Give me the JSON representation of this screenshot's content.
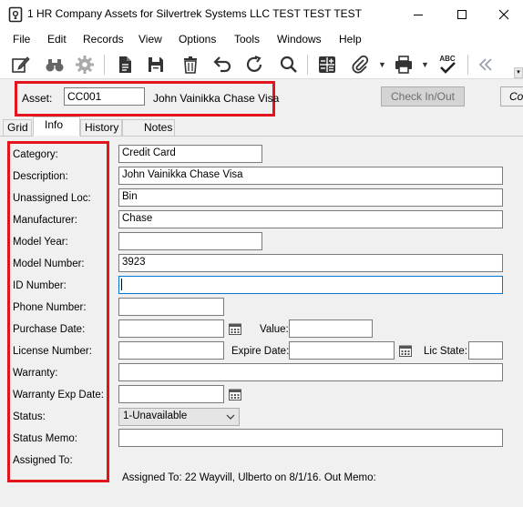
{
  "window": {
    "title": "1 HR Company Assets for Silvertrek Systems LLC TEST TEST TEST",
    "controls": [
      "minimize-icon",
      "maximize-icon",
      "close-icon"
    ]
  },
  "menu": [
    "File",
    "Edit",
    "Records",
    "View",
    "Options",
    "Tools",
    "Windows",
    "Help"
  ],
  "toolbar": {
    "icons": [
      "edit-icon",
      "binoculars-icon",
      "gear-icon",
      "document-icon",
      "save-icon",
      "delete-icon",
      "undo-icon",
      "redo-icon",
      "search-icon",
      "calculator-icon",
      "attach-icon",
      "print-icon",
      "spellcheck-icon",
      "collapse-icon"
    ],
    "spell_label": "ABC"
  },
  "asset": {
    "label": "Asset:",
    "code": "CC001",
    "description": "John Vainikka Chase Visa",
    "checkin_label": "Check In/Out",
    "copy_label": "Cop"
  },
  "tabs": [
    "Grid",
    "Info",
    "History",
    "Notes"
  ],
  "active_tab": "Info",
  "form": {
    "category": {
      "label": "Category:",
      "value": "Credit Card"
    },
    "description": {
      "label": "Description:",
      "value": "John Vainikka Chase Visa"
    },
    "unassigned_loc": {
      "label": "Unassigned Loc:",
      "value": "Bin"
    },
    "manufacturer": {
      "label": "Manufacturer:",
      "value": "Chase"
    },
    "model_year": {
      "label": "Model Year:",
      "value": ""
    },
    "model_number": {
      "label": "Model Number:",
      "value": "3923"
    },
    "id_number": {
      "label": "ID Number:",
      "value": ""
    },
    "phone_number": {
      "label": "Phone Number:",
      "value": ""
    },
    "purchase_date": {
      "label": "Purchase Date:",
      "value": ""
    },
    "value": {
      "label": "Value:",
      "value": ""
    },
    "license_number": {
      "label": "License Number:",
      "value": ""
    },
    "expire_date": {
      "label": "Expire Date:",
      "value": ""
    },
    "lic_state": {
      "label": "Lic State:",
      "value": ""
    },
    "warranty": {
      "label": "Warranty:",
      "value": ""
    },
    "warranty_exp_date": {
      "label": "Warranty Exp Date:",
      "value": ""
    },
    "status": {
      "label": "Status:",
      "value": "1-Unavailable"
    },
    "status_memo": {
      "label": "Status Memo:",
      "value": ""
    },
    "assigned_to": {
      "label": "Assigned To:"
    }
  },
  "footer_note": "Assigned To: 22 Wayvill, Ulberto on 8/1/16.  Out Memo:",
  "colors": {
    "highlight_red": "#e3141b",
    "focus_blue": "#0078d7"
  }
}
